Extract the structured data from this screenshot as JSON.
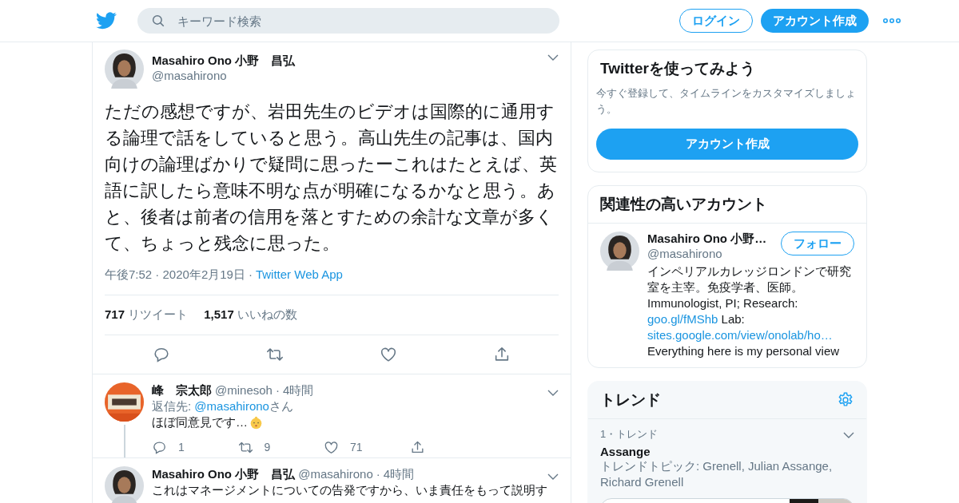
{
  "header": {
    "search": {
      "placeholder": "キーワード検索"
    },
    "login": "ログイン",
    "signup": "アカウント作成"
  },
  "tweet": {
    "name": "Masahiro Ono 小野　昌弘",
    "handle": "@masahirono",
    "text": "ただの感想ですが、岩田先生のビデオは国際的に通用する論理で話をしていると思う。高山先生の記事は、国内向けの論理ばかりで疑問に思ったーこれはたとえば、英語に訳したら意味不明な点が明確になるかなと思う。あと、後者は前者の信用を落とすための余計な文章が多くて、ちょっと残念に思った。",
    "timestamp": "午後7:52 · 2020年2月19日",
    "separator": "·",
    "source": "Twitter Web App",
    "stats": [
      {
        "count": "717",
        "label": "リツイート"
      },
      {
        "count": "1,517",
        "label": "いいねの数"
      }
    ],
    "actions": [
      {
        "kind": "reply"
      },
      {
        "kind": "retweet"
      },
      {
        "kind": "like"
      },
      {
        "kind": "share"
      }
    ]
  },
  "replies": [
    {
      "name": "峰　宗太郎",
      "handle": "@minesoh",
      "separator": "·",
      "time": "4時間",
      "reply_to": {
        "prefix": "返信先: ",
        "handle": "@masahirono",
        "suffix": "さん"
      },
      "text": "ほぼ同意見です…",
      "emoji": true,
      "actions": [
        {
          "kind": "reply",
          "count": "1"
        },
        {
          "kind": "retweet",
          "count": "9"
        },
        {
          "kind": "like",
          "count": "71"
        },
        {
          "kind": "share"
        }
      ]
    },
    {
      "name": "Masahiro Ono 小野　昌弘",
      "handle": "@masahirono",
      "separator": "·",
      "time": "4時間",
      "text": "これはマネージメントについての告発ですから、いま責任をもって説明す"
    }
  ],
  "signup_card": {
    "title": "Twitterを使ってみよう",
    "description": "今すぐ登録して、タイムラインをカスタマイズしましょう。",
    "button": "アカウント作成"
  },
  "related": {
    "title": "関連性の高いアカウント",
    "accounts": [
      {
        "name": "Masahiro Ono 小野…",
        "handle": "@masahirono",
        "follow": "フォロー",
        "bio": [
          {
            "kind": "text",
            "text": "インペリアルカレッジロンドンで研究室を主宰。免疫学者、医師。 Immunologist, PI; Research: "
          },
          {
            "kind": "link",
            "text": "goo.gl/fMShb"
          },
          {
            "kind": "text",
            "text": " Lab: "
          },
          {
            "kind": "link",
            "text": "sites.google.com/view/onolab/ho…"
          },
          {
            "kind": "text",
            "text": " Everything here is my personal view"
          }
        ]
      }
    ]
  },
  "trends": {
    "title": "トレンド",
    "items": [
      {
        "meta": "1・トレンド",
        "name": "Assange",
        "description": "トレンドトピック: Grenell, Julian Assange, Richard Grenell",
        "has_media": true
      }
    ]
  }
}
